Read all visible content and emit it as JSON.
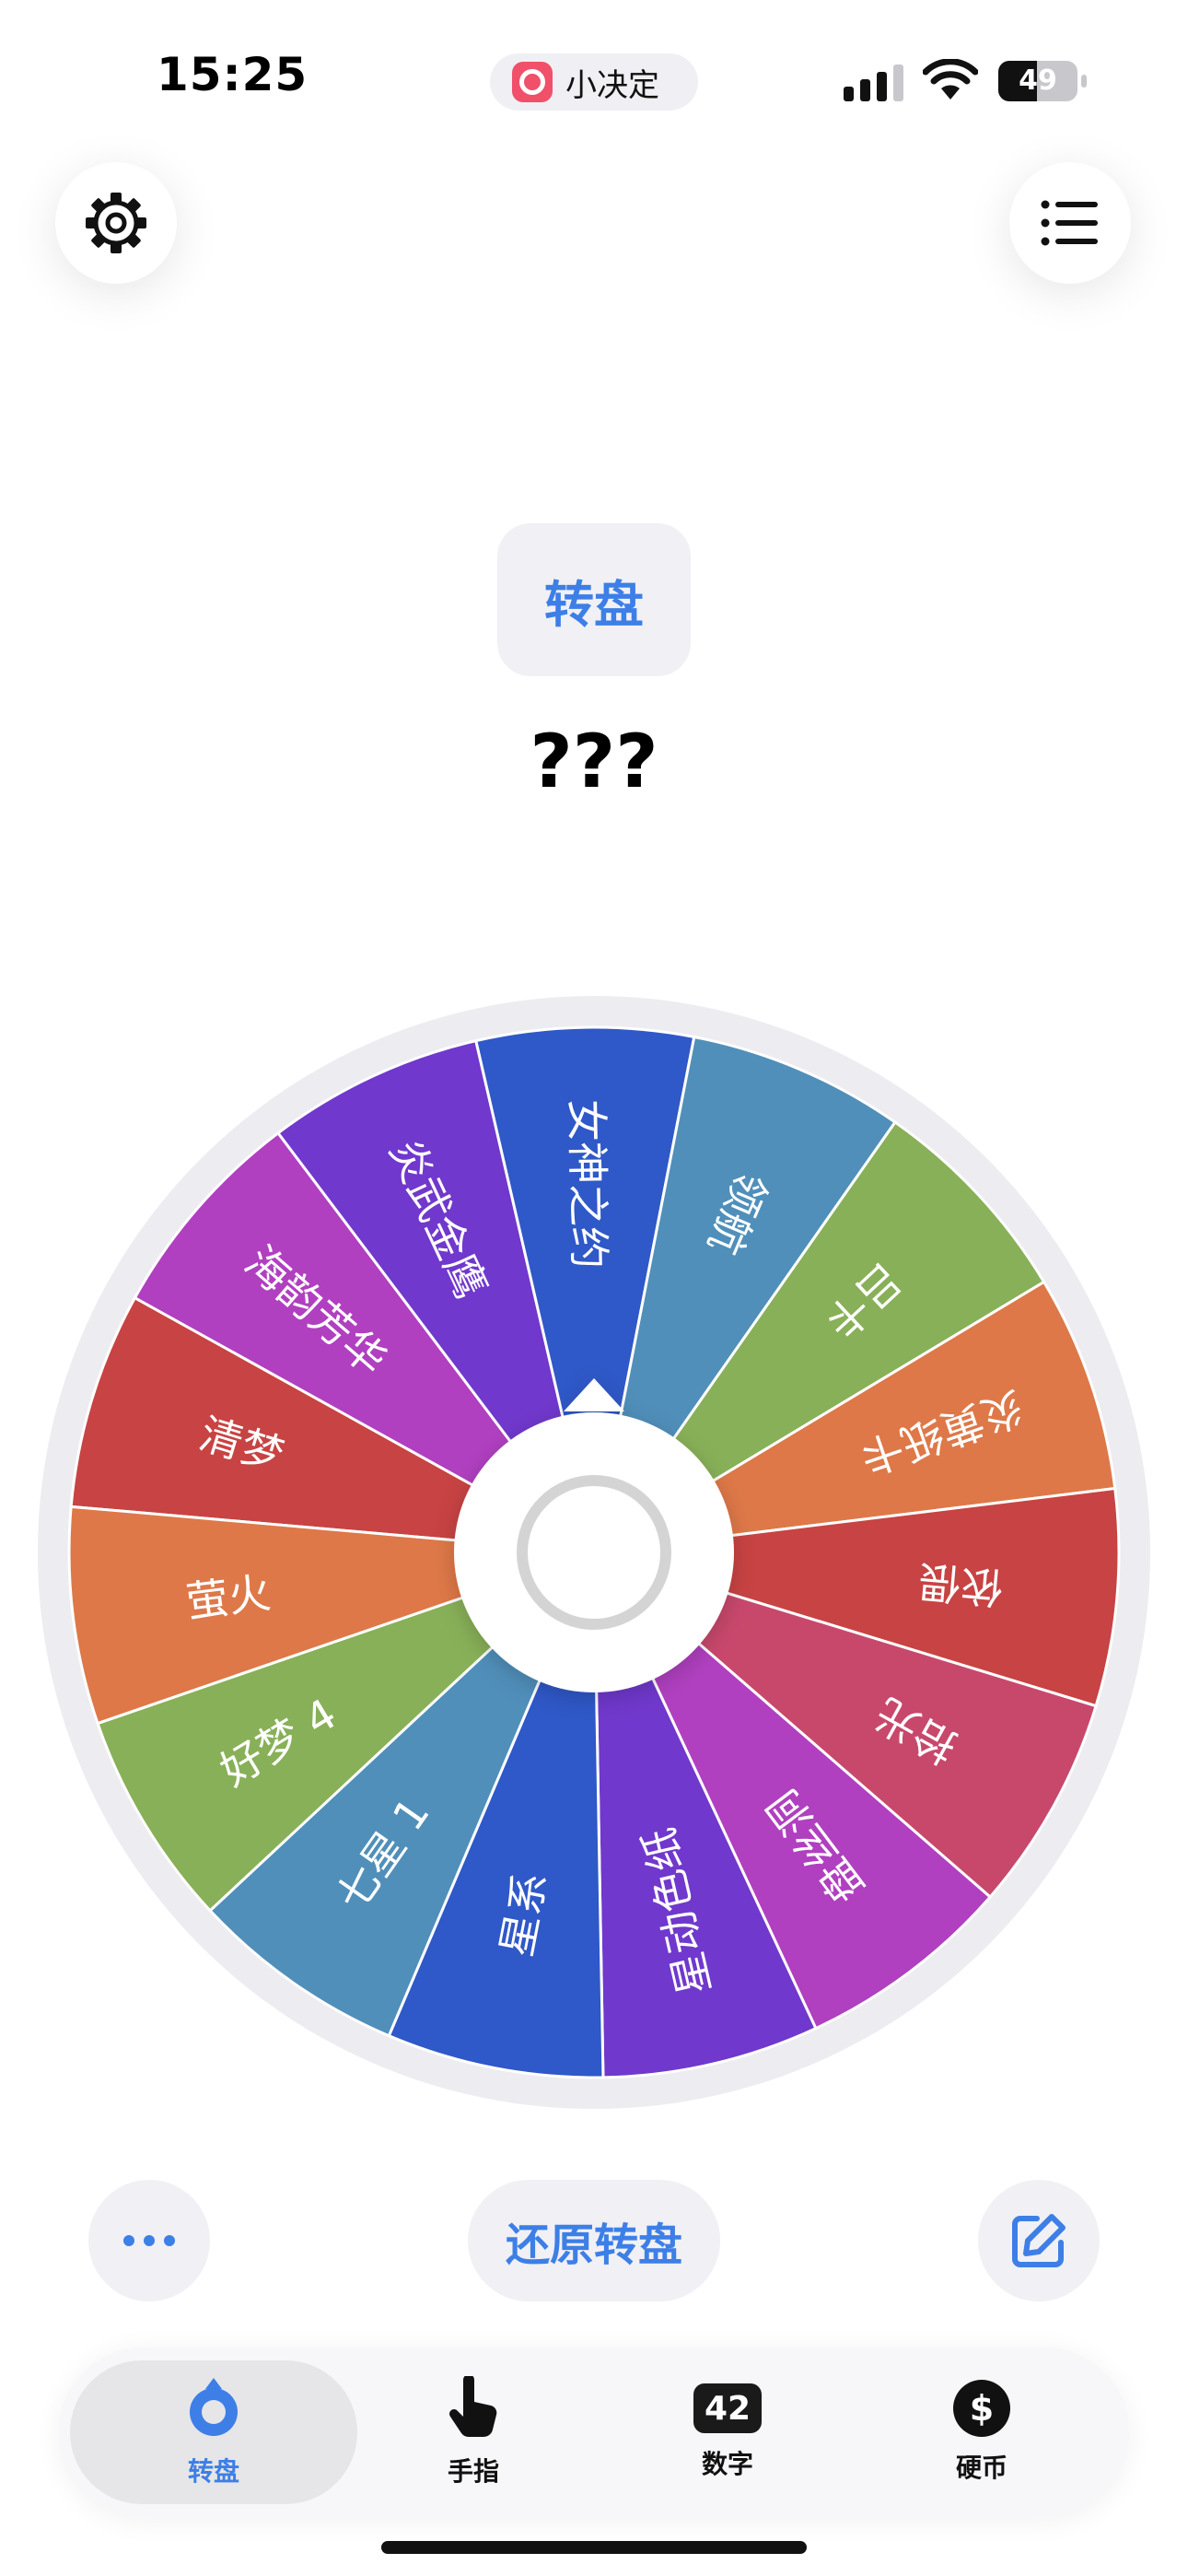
{
  "status_bar": {
    "time": "15:25",
    "app_name": "小决定",
    "battery": "49",
    "battery_level": 0.49
  },
  "header": {
    "mode_label": "转盘",
    "result": "???"
  },
  "wheel": {
    "segments": [
      {
        "label": "清梦",
        "color": "#c84343"
      },
      {
        "label": "海韵芳华",
        "color": "#b040c0"
      },
      {
        "label": "炎武金鹰",
        "color": "#7038cc"
      },
      {
        "label": "女神之约",
        "color": "#2f58c8"
      },
      {
        "label": "领航",
        "color": "#508fba"
      },
      {
        "label": "吕卡",
        "color": "#88b058"
      },
      {
        "label": "炎黄纸卡",
        "color": "#de7848"
      },
      {
        "label": "依偎",
        "color": "#c84343"
      },
      {
        "label": "拾光",
        "color": "#c8486c"
      },
      {
        "label": "盘丝洞",
        "color": "#b040c0"
      },
      {
        "label": "星动色纸",
        "color": "#7038cc"
      },
      {
        "label": "星系",
        "color": "#2f58c8"
      },
      {
        "label": "七星 1",
        "color": "#508fba"
      },
      {
        "label": "好梦 4",
        "color": "#88b058"
      },
      {
        "label": "萤火",
        "color": "#de7848"
      }
    ]
  },
  "controls": {
    "reset_label": "还原转盘"
  },
  "tabs": [
    {
      "label": "转盘"
    },
    {
      "label": "手指"
    },
    {
      "label": "数字",
      "badge": "42"
    },
    {
      "label": "硬币",
      "badge": "$"
    }
  ],
  "colors": {
    "accent": "#3d7fe6"
  }
}
